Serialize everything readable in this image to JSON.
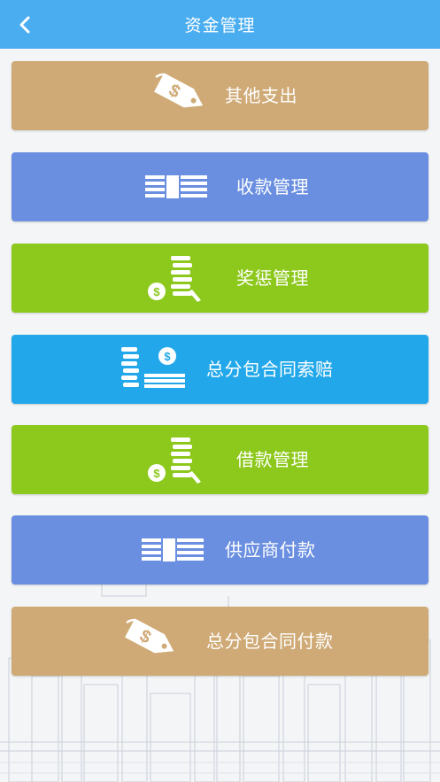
{
  "header": {
    "title": "资金管理",
    "bg_color": "#49adf0"
  },
  "menu": [
    {
      "label": "其他支出",
      "icon": "price-tag-dollar-icon",
      "color": "#cfaa76"
    },
    {
      "label": "收款管理",
      "icon": "cash-stack-icon",
      "color": "#6a8fe0"
    },
    {
      "label": "奖惩管理",
      "icon": "coin-stack-icon",
      "color": "#8dc81c"
    },
    {
      "label": "总分包合同索赔",
      "icon": "coins-and-cash-icon",
      "color": "#22a8ea"
    },
    {
      "label": "借款管理",
      "icon": "coin-stack-icon",
      "color": "#8dc81c"
    },
    {
      "label": "供应商付款",
      "icon": "cash-stack-icon",
      "color": "#6a8fe0"
    },
    {
      "label": "总分包合同付款",
      "icon": "price-tag-dollar-icon",
      "color": "#cfaa76"
    }
  ]
}
